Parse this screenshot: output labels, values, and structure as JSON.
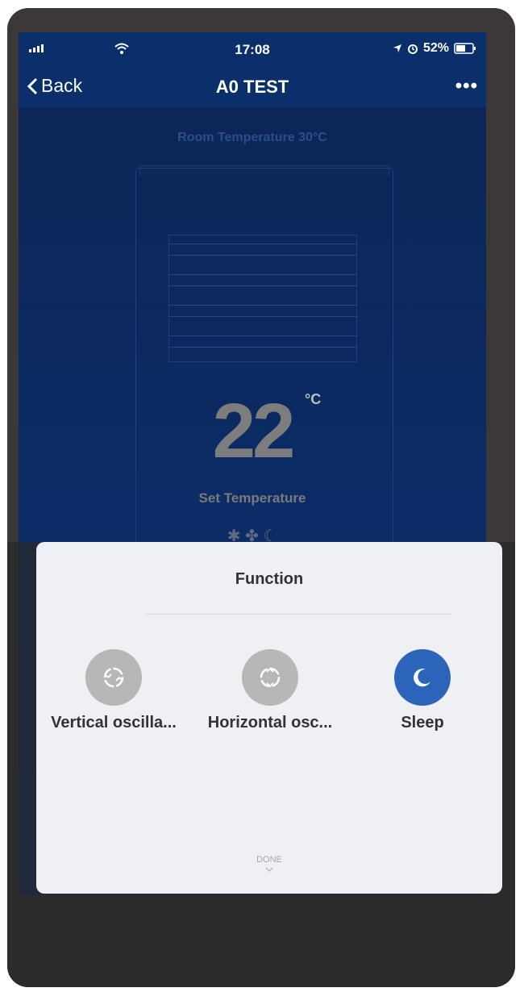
{
  "status_bar": {
    "time": "17:08",
    "battery": "52%"
  },
  "nav": {
    "back_label": "Back",
    "title": "A0 TEST",
    "more_label": "•••"
  },
  "device": {
    "room_temperature": "Room Temperature  30°C",
    "set_temperature_value": "22",
    "unit": "°C",
    "set_temperature_label": "Set Temperature",
    "mode_icons": [
      "snowflake-icon",
      "fan-icon",
      "moon-icon"
    ]
  },
  "sheet": {
    "title": "Function",
    "functions": [
      {
        "label": "Vertical oscilla...",
        "active": false,
        "icon": "vertical-oscillation-icon"
      },
      {
        "label": "Horizontal osc...",
        "active": false,
        "icon": "horizontal-oscillation-icon"
      },
      {
        "label": "Sleep",
        "active": true,
        "icon": "moon-icon"
      }
    ],
    "done_label": "DONE"
  },
  "colors": {
    "nav_bg": "#0a2f6a",
    "active": "#2b64b8",
    "inactive": "#b7b7b7"
  }
}
